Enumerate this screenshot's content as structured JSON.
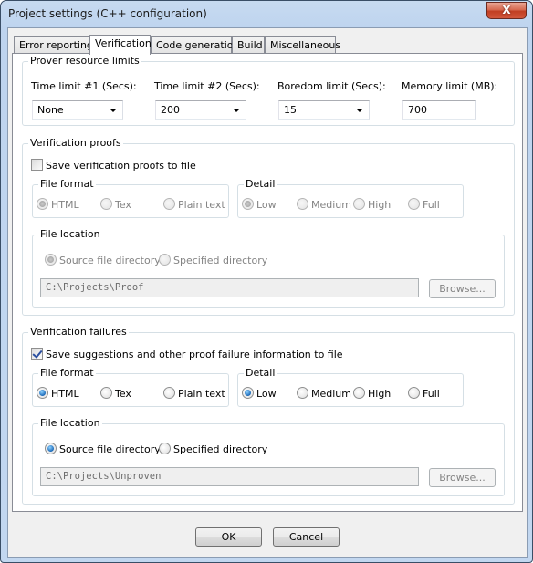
{
  "window": {
    "title": "Project settings (C++ configuration)",
    "close_glyph": "X"
  },
  "tabs": [
    {
      "label": "Error reporting",
      "active": false
    },
    {
      "label": "Verification",
      "active": true
    },
    {
      "label": "Code generation",
      "active": false
    },
    {
      "label": "Build",
      "active": false
    },
    {
      "label": "Miscellaneous",
      "active": false
    }
  ],
  "prover_limits": {
    "title": "Prover resource limits",
    "time_limit_1": {
      "label": "Time limit #1 (Secs):",
      "value": "None"
    },
    "time_limit_2": {
      "label": "Time limit #2 (Secs):",
      "value": "200"
    },
    "boredom_limit": {
      "label": "Boredom limit (Secs):",
      "value": "15"
    },
    "memory_limit": {
      "label": "Memory limit (MB):",
      "value": "700"
    }
  },
  "proofs": {
    "title": "Verification proofs",
    "save_label": "Save verification proofs to file",
    "save_checked": false,
    "file_format": {
      "title": "File format",
      "options": [
        "HTML",
        "Tex",
        "Plain text"
      ],
      "selected": "HTML"
    },
    "detail": {
      "title": "Detail",
      "options": [
        "Low",
        "Medium",
        "High",
        "Full"
      ],
      "selected": "Low"
    },
    "file_location": {
      "title": "File location",
      "options": [
        "Source file directory",
        "Specified directory"
      ],
      "selected": "Source file directory",
      "path": "C:\\Projects\\Proof",
      "browse_label": "Browse..."
    }
  },
  "failures": {
    "title": "Verification failures",
    "save_label": "Save suggestions and other proof failure information to file",
    "save_checked": true,
    "file_format": {
      "title": "File format",
      "options": [
        "HTML",
        "Tex",
        "Plain text"
      ],
      "selected": "HTML"
    },
    "detail": {
      "title": "Detail",
      "options": [
        "Low",
        "Medium",
        "High",
        "Full"
      ],
      "selected": "Low"
    },
    "file_location": {
      "title": "File location",
      "options": [
        "Source file directory",
        "Specified directory"
      ],
      "selected": "Source file directory",
      "path": "C:\\Projects\\Unproven",
      "browse_label": "Browse..."
    }
  },
  "buttons": {
    "ok": "OK",
    "cancel": "Cancel"
  }
}
